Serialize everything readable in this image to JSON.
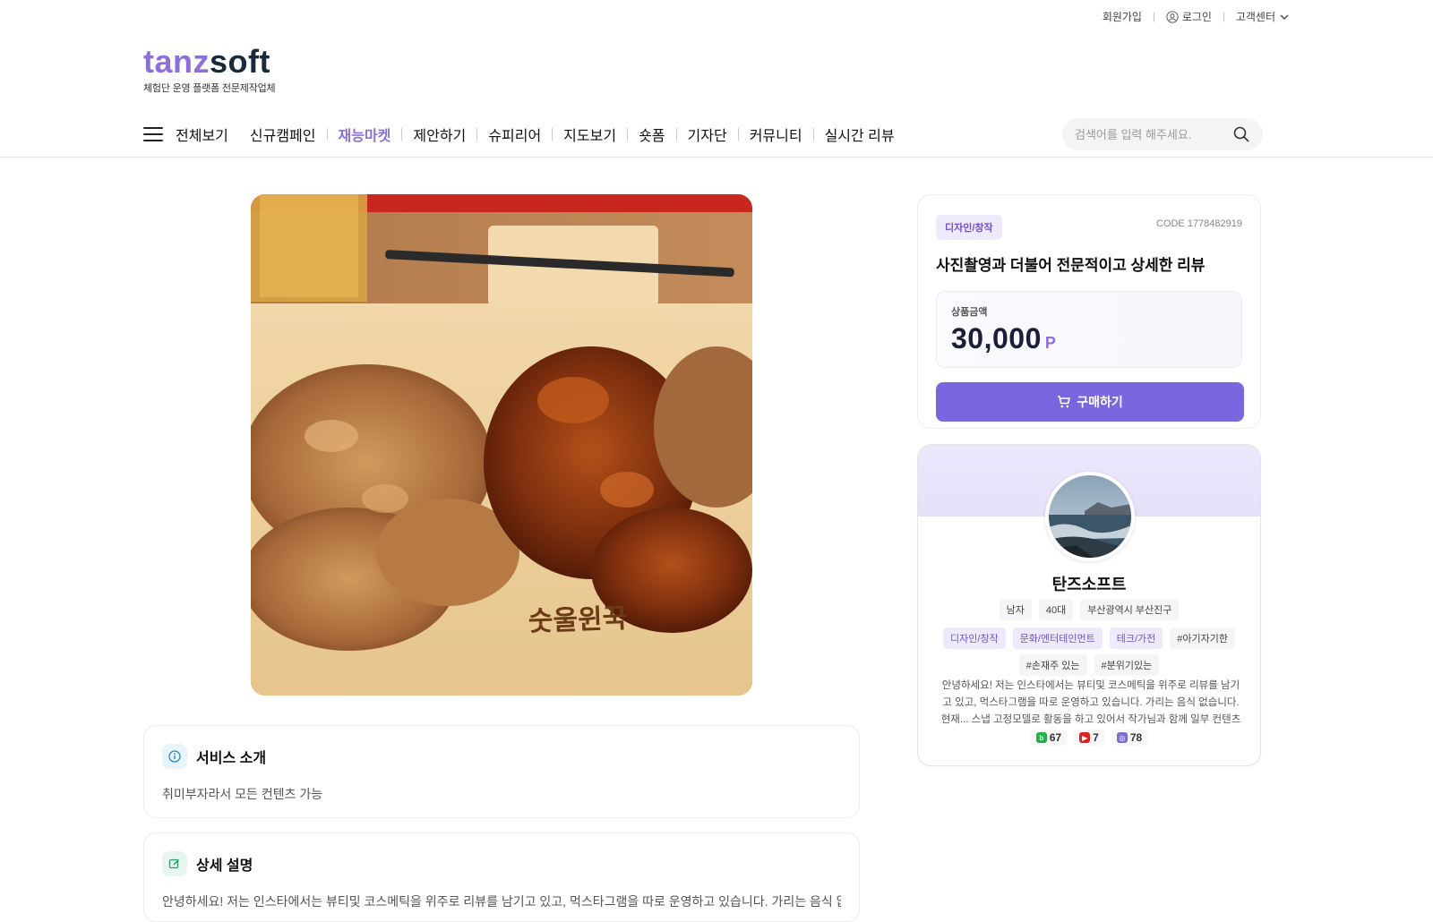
{
  "topbar": {
    "signup": "회원가입",
    "login": "로그인",
    "support": "고객센터"
  },
  "logo": {
    "part1": "tanz",
    "part2": "soft",
    "tagline": "체험단 운영 플랫폼 전문제작업체"
  },
  "nav": {
    "items": [
      "전체보기",
      "신규캠페인",
      "재능마켓",
      "제안하기",
      "슈피리어",
      "지도보기",
      "숏폼",
      "기자단",
      "커뮤니티",
      "실시간 리뷰"
    ],
    "active": "재능마켓"
  },
  "search": {
    "placeholder": "검색어를 입력 해주세요."
  },
  "product": {
    "category": "디자인/창작",
    "code": "CODE 1778482919",
    "title": "사진촬영과 더불어 전문적이고 상세한 리뷰",
    "price_label": "상품금액",
    "price": "30,000",
    "price_unit": "P",
    "buy_label": "구매하기"
  },
  "profile": {
    "name": "탄즈소프트",
    "gender": "남자",
    "age": "40대",
    "region": "부산광역시 부산진구",
    "categories": [
      "디자인/창작",
      "문화/엔터테인먼트",
      "테크/가전"
    ],
    "hashtags": [
      "#아기자기한",
      "#손재주 있는",
      "#분위기있는"
    ],
    "description": "안녕하세요! 저는 인스타에서는 뷰티및 코스메틱을 위주로 리뷰를 남기고 있고, 먹스타그램을 따로 운영하고 있습니다. 가리는 음식 없습니다. 현재... 스냅 고정모델로 활동을 하고 있어서 작가님과 함께 일부 컨텐츠 촬영도 가",
    "stats": {
      "blog": "67",
      "youtube": "7",
      "instagram": "78"
    }
  },
  "service": {
    "title": "서비스 소개",
    "text": "취미부자라서 모든 컨텐츠 가능"
  },
  "detail": {
    "title": "상세 설명",
    "text": "안녕하세요! 저는 인스타에서는 뷰티및 코스메틱을 위주로 리뷰를 남기고 있고, 먹스타그램을 따로 운영하고 있습니다. 가리는 음식 없습니다."
  },
  "colors": {
    "accent": "#8d6fd8",
    "button": "#7a66de",
    "navy": "#1b1f3a"
  }
}
